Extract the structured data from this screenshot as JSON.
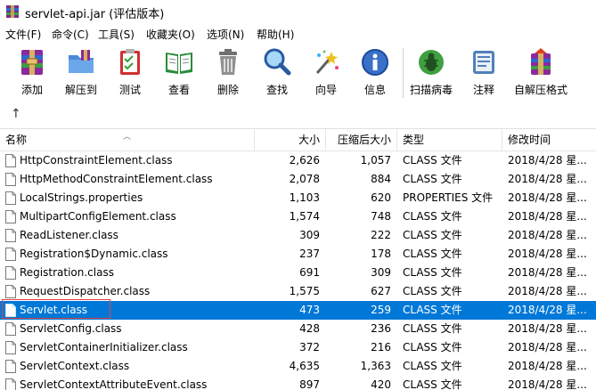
{
  "window": {
    "title": "servlet-api.jar (评估版本)"
  },
  "menu": [
    {
      "label": "文件(F)"
    },
    {
      "label": "命令(C)"
    },
    {
      "label": "工具(S)"
    },
    {
      "label": "收藏夹(O)"
    },
    {
      "label": "选项(N)"
    },
    {
      "label": "帮助(H)"
    }
  ],
  "toolbar": [
    {
      "label": "添加",
      "icon": "add-archive-icon"
    },
    {
      "label": "解压到",
      "icon": "extract-to-icon"
    },
    {
      "label": "测试",
      "icon": "test-icon"
    },
    {
      "label": "查看",
      "icon": "view-icon"
    },
    {
      "label": "删除",
      "icon": "delete-icon"
    },
    {
      "label": "查找",
      "icon": "find-icon"
    },
    {
      "label": "向导",
      "icon": "wizard-icon"
    },
    {
      "label": "信息",
      "icon": "info-icon"
    },
    {
      "label": "扫描病毒",
      "icon": "virus-scan-icon"
    },
    {
      "label": "注释",
      "icon": "comment-icon"
    },
    {
      "label": "自解压格式",
      "icon": "sfx-icon"
    }
  ],
  "upbar": {
    "icon": "up-arrow-icon",
    "glyph": "↑"
  },
  "columns": {
    "name": "名称",
    "size": "大小",
    "packed": "压缩后大小",
    "type": "类型",
    "modified": "修改时间"
  },
  "files": [
    {
      "name": "HttpConstraintElement.class",
      "size": "2,626",
      "packed": "1,057",
      "type": "CLASS 文件",
      "modified": "2018/4/28 星..."
    },
    {
      "name": "HttpMethodConstraintElement.class",
      "size": "2,078",
      "packed": "884",
      "type": "CLASS 文件",
      "modified": "2018/4/28 星..."
    },
    {
      "name": "LocalStrings.properties",
      "size": "1,103",
      "packed": "620",
      "type": "PROPERTIES 文件",
      "modified": "2018/4/28 星..."
    },
    {
      "name": "MultipartConfigElement.class",
      "size": "1,574",
      "packed": "748",
      "type": "CLASS 文件",
      "modified": "2018/4/28 星..."
    },
    {
      "name": "ReadListener.class",
      "size": "309",
      "packed": "222",
      "type": "CLASS 文件",
      "modified": "2018/4/28 星..."
    },
    {
      "name": "Registration$Dynamic.class",
      "size": "237",
      "packed": "178",
      "type": "CLASS 文件",
      "modified": "2018/4/28 星..."
    },
    {
      "name": "Registration.class",
      "size": "691",
      "packed": "309",
      "type": "CLASS 文件",
      "modified": "2018/4/28 星..."
    },
    {
      "name": "RequestDispatcher.class",
      "size": "1,575",
      "packed": "627",
      "type": "CLASS 文件",
      "modified": "2018/4/28 星..."
    },
    {
      "name": "Servlet.class",
      "size": "473",
      "packed": "259",
      "type": "CLASS 文件",
      "modified": "2018/4/28 星...",
      "selected": true
    },
    {
      "name": "ServletConfig.class",
      "size": "428",
      "packed": "236",
      "type": "CLASS 文件",
      "modified": "2018/4/28 星..."
    },
    {
      "name": "ServletContainerInitializer.class",
      "size": "372",
      "packed": "216",
      "type": "CLASS 文件",
      "modified": "2018/4/28 星..."
    },
    {
      "name": "ServletContext.class",
      "size": "4,635",
      "packed": "1,363",
      "type": "CLASS 文件",
      "modified": "2018/4/28 星..."
    },
    {
      "name": "ServletContextAttributeEvent.class",
      "size": "897",
      "packed": "420",
      "type": "CLASS 文件",
      "modified": "2018/4/28 星..."
    }
  ]
}
